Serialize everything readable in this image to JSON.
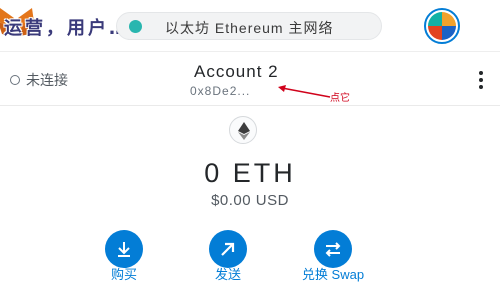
{
  "header": {
    "overlay_text": "运营，用户…………则是送接给",
    "network": {
      "name": "以太坊 Ethereum 主网络",
      "dot_color": "#29b6af"
    },
    "avatar_icon": "jazzicon-avatar"
  },
  "account": {
    "connection_status": "未连接",
    "name": "Account 2",
    "address": "0x8De2...",
    "menu_icon": "kebab-menu-icon"
  },
  "annotation": {
    "text": "点它",
    "color": "#d0021b"
  },
  "balance": {
    "token_icon": "ethereum-icon",
    "primary": "0 ETH",
    "secondary": "$0.00 USD"
  },
  "actions": [
    {
      "label": "购买",
      "icon": "download-icon"
    },
    {
      "label": "发送",
      "icon": "arrow-up-right-icon"
    },
    {
      "label": "兑换 Swap",
      "icon": "swap-icon"
    }
  ],
  "colors": {
    "accent": "#037dd6",
    "text": "#24272a",
    "muted": "#6a737d"
  }
}
